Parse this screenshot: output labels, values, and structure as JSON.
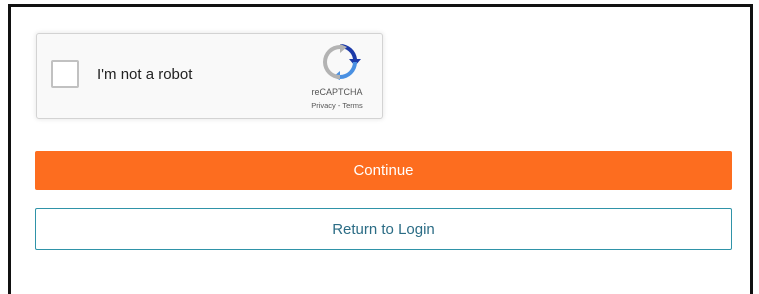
{
  "recaptcha": {
    "checkbox_label": "I'm not a robot",
    "brand": "reCAPTCHA",
    "privacy_link": "Privacy",
    "separator": " - ",
    "terms_link": "Terms",
    "logo_icon": "recaptcha-logo-icon",
    "checked": false
  },
  "actions": {
    "continue_label": "Continue",
    "return_label": "Return to Login"
  },
  "colors": {
    "continue_bg": "#fd6d1f",
    "return_border": "#2f93a8",
    "return_text": "#2b6c85",
    "logo_blue": "#1c3aa9",
    "logo_light_blue": "#4a90e2",
    "logo_gray": "#b3b3b3"
  }
}
